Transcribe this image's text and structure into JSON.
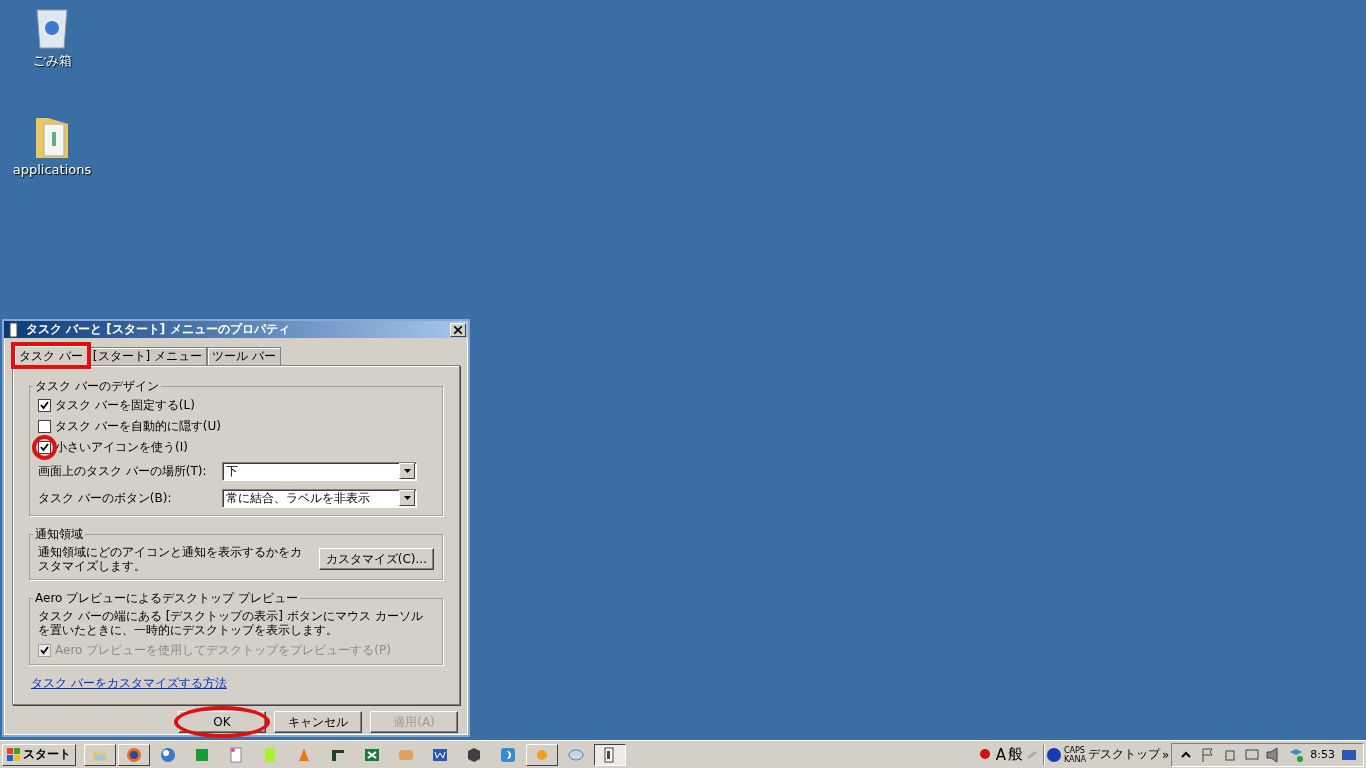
{
  "desktop_icons": [
    {
      "label": "ごみ箱",
      "kind": "bin"
    },
    {
      "label": "applications",
      "kind": "folder"
    }
  ],
  "dialog": {
    "title": "タスク バーと [スタート] メニューのプロパティ",
    "tabs": [
      {
        "label": "タスク バー",
        "selected": true,
        "highlighted": true
      },
      {
        "label": "[スタート] メニュー",
        "selected": false,
        "highlighted": false
      },
      {
        "label": "ツール バー",
        "selected": false,
        "highlighted": false
      }
    ],
    "design_group": {
      "title": "タスク バーのデザイン",
      "checkboxes": [
        {
          "label": "タスク バーを固定する(L)",
          "checked": true,
          "highlighted": false
        },
        {
          "label": "タスク バーを自動的に隠す(U)",
          "checked": false,
          "highlighted": false
        },
        {
          "label": "小さいアイコンを使う(I)",
          "checked": true,
          "highlighted": true
        }
      ],
      "dropdowns": [
        {
          "label": "画面上のタスク バーの場所(T):",
          "value": "下"
        },
        {
          "label": "タスク バーのボタン(B):",
          "value": "常に結合、ラベルを非表示"
        }
      ]
    },
    "notify_group": {
      "title": "通知領域",
      "text": "通知領域にどのアイコンと通知を表示するかをカスタマイズします。",
      "button": "カスタマイズ(C)..."
    },
    "aero_group": {
      "title": "Aero プレビューによるデスクトップ プレビュー",
      "text": "タスク バーの端にある [デスクトップの表示] ボタンにマウス カーソルを置いたときに、一時的にデスクトップを表示します。",
      "checkbox": {
        "label": "Aero プレビューを使用してデスクトップをプレビューする(P)",
        "checked": true,
        "disabled": true
      }
    },
    "link": "タスク バーをカスタマイズする方法",
    "buttons": [
      {
        "label": "OK",
        "disabled": false,
        "highlighted": true
      },
      {
        "label": "キャンセル",
        "disabled": false,
        "highlighted": false
      },
      {
        "label": "適用(A)",
        "disabled": true,
        "highlighted": false
      }
    ]
  },
  "taskbar": {
    "start": "スタート",
    "apps": [
      {
        "running": true,
        "active": false
      },
      {
        "running": true,
        "active": false
      },
      {
        "running": false,
        "active": false
      },
      {
        "running": false,
        "active": false
      },
      {
        "running": false,
        "active": false
      },
      {
        "running": false,
        "active": false
      },
      {
        "running": false,
        "active": false
      },
      {
        "running": false,
        "active": false
      },
      {
        "running": false,
        "active": false
      },
      {
        "running": false,
        "active": false
      },
      {
        "running": false,
        "active": false
      },
      {
        "running": false,
        "active": false
      },
      {
        "running": false,
        "active": false
      },
      {
        "running": true,
        "active": false
      },
      {
        "running": false,
        "active": false
      },
      {
        "running": true,
        "active": true
      }
    ],
    "ime": [
      "A",
      "般"
    ],
    "caps": "CAPS",
    "kana": "KANA",
    "toolbar": "デスクトップ",
    "chevron": "»",
    "clock": "8:53"
  }
}
